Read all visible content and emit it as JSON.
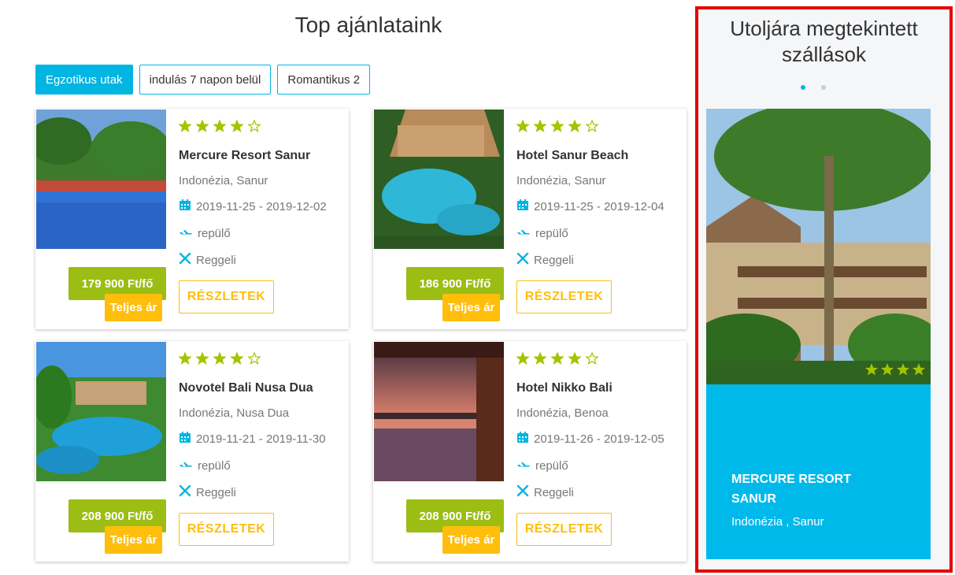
{
  "page_title": "Top ajánlataink",
  "tabs": [
    {
      "label": "Egzotikus utak",
      "active": true
    },
    {
      "label": "indulás 7 napon belül",
      "active": false
    },
    {
      "label": "Romantikus 2",
      "active": false
    }
  ],
  "colors": {
    "accent": "#00b5e2",
    "price": "#9cbd13",
    "full_price": "#ffbe0c",
    "stars": "#a5c400",
    "highlight_border": "#e30000"
  },
  "offers": [
    {
      "name": "Mercure Resort Sanur",
      "location": "Indonézia, Sanur",
      "dates": "2019-11-25 - 2019-12-02",
      "transport": "repülő",
      "board": "Reggeli",
      "price": "179 900 Ft/fő",
      "full_price_label": "Teljes ár",
      "details_label": "RÉSZLETEK",
      "rating": 4
    },
    {
      "name": "Hotel Sanur Beach",
      "location": "Indonézia, Sanur",
      "dates": "2019-11-25 - 2019-12-04",
      "transport": "repülő",
      "board": "Reggeli",
      "price": "186 900 Ft/fő",
      "full_price_label": "Teljes ár",
      "details_label": "RÉSZLETEK",
      "rating": 4
    },
    {
      "name": "Novotel Bali Nusa Dua",
      "location": "Indonézia, Nusa Dua",
      "dates": "2019-11-21 - 2019-11-30",
      "transport": "repülő",
      "board": "Reggeli",
      "price": "208 900 Ft/fő",
      "full_price_label": "Teljes ár",
      "details_label": "RÉSZLETEK",
      "rating": 4
    },
    {
      "name": "Hotel Nikko Bali",
      "location": "Indonézia, Benoa",
      "dates": "2019-11-26 - 2019-12-05",
      "transport": "repülő",
      "board": "Reggeli",
      "price": "208 900 Ft/fő",
      "full_price_label": "Teljes ár",
      "details_label": "RÉSZLETEK",
      "rating": 4
    }
  ],
  "icons": {
    "calendar": "calendar-icon",
    "transport": "plane-icon",
    "board": "cutlery-icon",
    "star": "star-icon"
  },
  "recent": {
    "title": "Utoljára megtekintett szállások",
    "slide_count": 2,
    "active_slide": 1,
    "hotel_name": "MERCURE RESORT SANUR",
    "location": "Indonézia , Sanur",
    "rating": 4
  }
}
